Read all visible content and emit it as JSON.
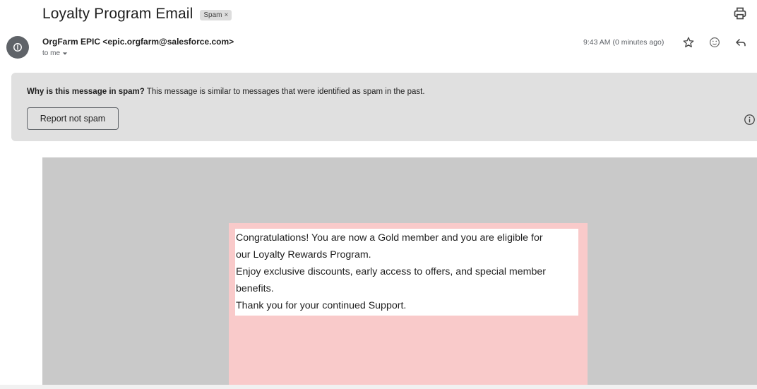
{
  "email": {
    "subject": "Loyalty Program Email",
    "label_chip": "Spam",
    "label_remove": "×",
    "sender": "OrgFarm EPIC <epic.orgfarm@salesforce.com>",
    "recipient": "to me",
    "time": "9:43 AM (0 minutes ago)"
  },
  "icons": {
    "print": "print-icon",
    "avatar": "person-icon",
    "star": "star-icon",
    "emoji": "emoji-reaction-icon",
    "reply": "reply-icon",
    "info": "info-icon",
    "dropdown": "caret-down-icon"
  },
  "spam_banner": {
    "title": "Why is this message in spam?",
    "message": " This message is similar to messages that were identified as spam in the past.",
    "button_label": "Report not spam"
  },
  "body": {
    "lines": [
      "Congratulations! You are now a Gold member and you are eligible for",
      "our Loyalty Rewards Program.",
      "Enjoy exclusive discounts, early access to offers, and special member",
      "benefits.",
      "Thank you for your continued Support."
    ]
  },
  "colors": {
    "banner_bg": "#e0e0e0",
    "body_bg": "#c9c9c9",
    "panel_bg": "#f9caca",
    "avatar_bg": "#5f6368"
  }
}
